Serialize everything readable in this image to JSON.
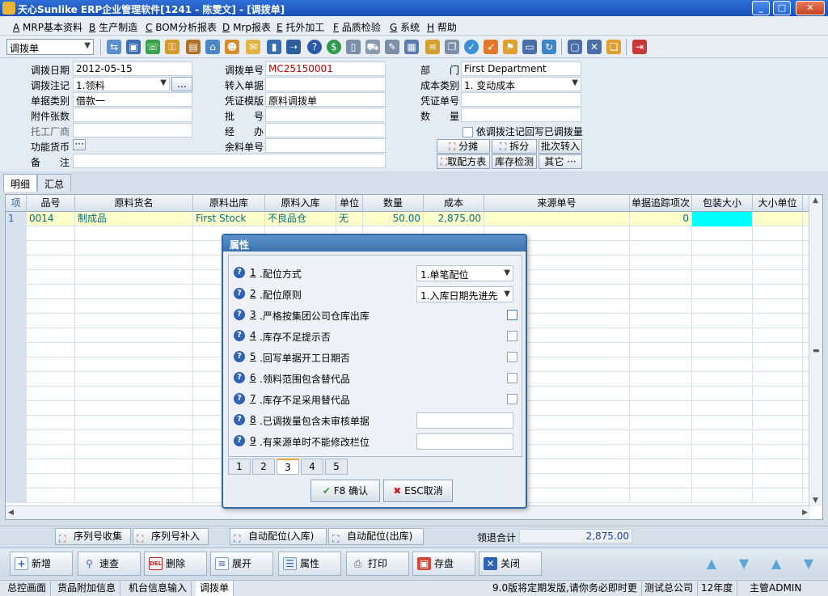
{
  "window": {
    "title": "天心Sunlike ERP企业管理软件[1241 - 陈雯文] - [调拨单]",
    "controls": [
      "_",
      "□",
      "✕"
    ]
  },
  "menu": [
    {
      "key": "A",
      "label": "MRP基本资料"
    },
    {
      "key": "B",
      "label": "生产制造"
    },
    {
      "key": "C",
      "label": "BOM分析报表"
    },
    {
      "key": "D",
      "label": "Mrp报表"
    },
    {
      "key": "E",
      "label": "托外加工"
    },
    {
      "key": "F",
      "label": "品质检验"
    },
    {
      "key": "G",
      "label": "系统"
    },
    {
      "key": "H",
      "label": "帮助"
    }
  ],
  "toolbar": {
    "doc_type": "调拨单"
  },
  "form": {
    "labels": {
      "date": "调拨日期",
      "note_type": "调拨注记",
      "doc_class": "单据类别",
      "attach_count": "附件张数",
      "factory": "托工厂商",
      "currency": "功能货币",
      "remark": "备　　注",
      "doc_no": "调拨单号",
      "transfer_in": "转入单据",
      "template": "凭证模版",
      "batch": "批　　号",
      "handler": "经　　办",
      "rest_no": "余料单号",
      "dept": "部　　门",
      "cost_type": "成本类别",
      "voucher_no": "凭证单号",
      "qty": "数　　量"
    },
    "values": {
      "date": "2012-05-15",
      "note_type": "1.领料",
      "doc_class": "借款一",
      "doc_no": "MC25150001",
      "template": "原料调拨单",
      "dept": "First Department",
      "cost_type": "1. 变动成本"
    },
    "ellipsis": "...",
    "currency_btn": "···",
    "writeback_label": "依调拨注记回写已调拨量",
    "buttons": {
      "split_alloc": "分摊",
      "split": "拆分",
      "batch_in": "批次转入",
      "get_plan": "取配方表",
      "stock_check": "库存检测",
      "other": "其它 ···"
    }
  },
  "tabs": [
    "明细",
    "汇总"
  ],
  "grid": {
    "headers": [
      "项",
      "品号",
      "原料货名",
      "原料出库",
      "原料入库",
      "单位",
      "数量",
      "成本",
      "来源单号",
      "单据追踪项次",
      "包装大小",
      "大小单位"
    ],
    "rows": [
      {
        "idx": "1",
        "code": "0014",
        "name": "制成品",
        "out_wh": "First Stock",
        "in_wh": "不良品仓",
        "unit": "无",
        "qty": "50.00",
        "cost": "2,875.00",
        "src": "",
        "trace": "0",
        "pack": "",
        "size_unit": ""
      }
    ]
  },
  "dialog": {
    "title": "属性",
    "items": [
      {
        "num": "1",
        "label": ".配位方式",
        "type": "select",
        "value": "1.单笔配位"
      },
      {
        "num": "2",
        "label": ".配位原则",
        "type": "select",
        "value": "1.入库日期先进先"
      },
      {
        "num": "3",
        "label": ".严格按集团公司仓库出库",
        "type": "check"
      },
      {
        "num": "4",
        "label": ".库存不足提示否",
        "type": "check"
      },
      {
        "num": "5",
        "label": ".回写单据开工日期否",
        "type": "check"
      },
      {
        "num": "6",
        "label": ".领料范围包含替代品",
        "type": "check"
      },
      {
        "num": "7",
        "label": ".库存不足采用替代品",
        "type": "check"
      },
      {
        "num": "8",
        "label": ".已调拨量包含未审核单据",
        "type": "text",
        "value": ""
      },
      {
        "num": "9",
        "label": ".有来源单时不能修改栏位",
        "type": "text",
        "value": ""
      }
    ],
    "pages": [
      "1",
      "2",
      "3",
      "4",
      "5"
    ],
    "active_page": "3",
    "ok_label": "F8 确认",
    "cancel_label": "ESC取消"
  },
  "bottom_actions": {
    "serial_collect": "序列号收集",
    "serial_fill": "序列号补入",
    "auto_in": "自动配位(入库)",
    "auto_out": "自动配位(出库)",
    "total_label": "领退合计",
    "total_value": "2,875.00"
  },
  "action_bar": {
    "add": "新增",
    "quick": "速查",
    "delete": "删除",
    "expand": "展开",
    "prop": "属性",
    "print": "打印",
    "save": "存盘",
    "close": "关闭"
  },
  "status": {
    "cells": [
      "总控画面",
      "货品附加信息",
      "机台信息输入",
      "调拨单"
    ],
    "notice": "9.0版将定期发版,请你务必即时更",
    "company": "测试总公司",
    "year": "12年度",
    "user": "主管ADMIN"
  },
  "icons": {
    "add": "plus-icon",
    "quick": "magnifier-icon",
    "delete": "del-icon",
    "expand": "expand-icon",
    "prop": "properties-icon",
    "print": "printer-icon",
    "save": "disk-icon",
    "close": "close-x-icon",
    "ok": "checkmark-icon",
    "cancel": "x-icon",
    "question": "question-icon"
  },
  "colors": {
    "accent": "#2f6fd6",
    "row_highlight": "#ffffcc",
    "cell_cyan": "#00ffff",
    "doc_no_red": "#c00000",
    "total_blue": "#1b3fa8"
  }
}
